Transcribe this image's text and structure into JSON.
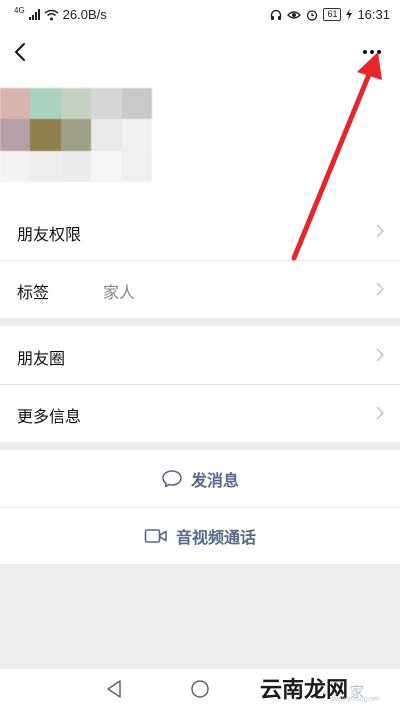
{
  "status_bar": {
    "network_type": "4G",
    "speed": "26.0B/s",
    "battery": "61",
    "time": "16:31"
  },
  "nav": {
    "back_icon": "chevron-left-icon",
    "more_icon": "more-dots-icon"
  },
  "profile": {
    "avatar_mosaic": [
      "#d7b3ae",
      "#a7d3bf",
      "#c4d3bf",
      "#d6d6d6",
      "#c9c9c9",
      "#b79fa6",
      "#8f7f4c",
      "#9c9f86",
      "#e9e9e9",
      "#f1f1f1",
      "#f4f4f4",
      "#eeeeee",
      "#ececec",
      "#f6f6f6",
      "#f0f0f0"
    ]
  },
  "settings": {
    "group1": [
      {
        "label": "朋友权限",
        "value": ""
      },
      {
        "label": "标签",
        "value": "家人"
      }
    ],
    "group2": [
      {
        "label": "朋友圈",
        "value": ""
      },
      {
        "label": "更多信息",
        "value": ""
      }
    ]
  },
  "actions": {
    "message_label": "发消息",
    "message_icon": "chat-bubble-icon",
    "call_label": "音视频通话",
    "call_icon": "video-camera-icon"
  },
  "annotation": {
    "arrow_color": "#e8252b"
  },
  "watermark": {
    "main": "云南龙网",
    "sub": "家",
    "url": "www.ynlong.net"
  }
}
